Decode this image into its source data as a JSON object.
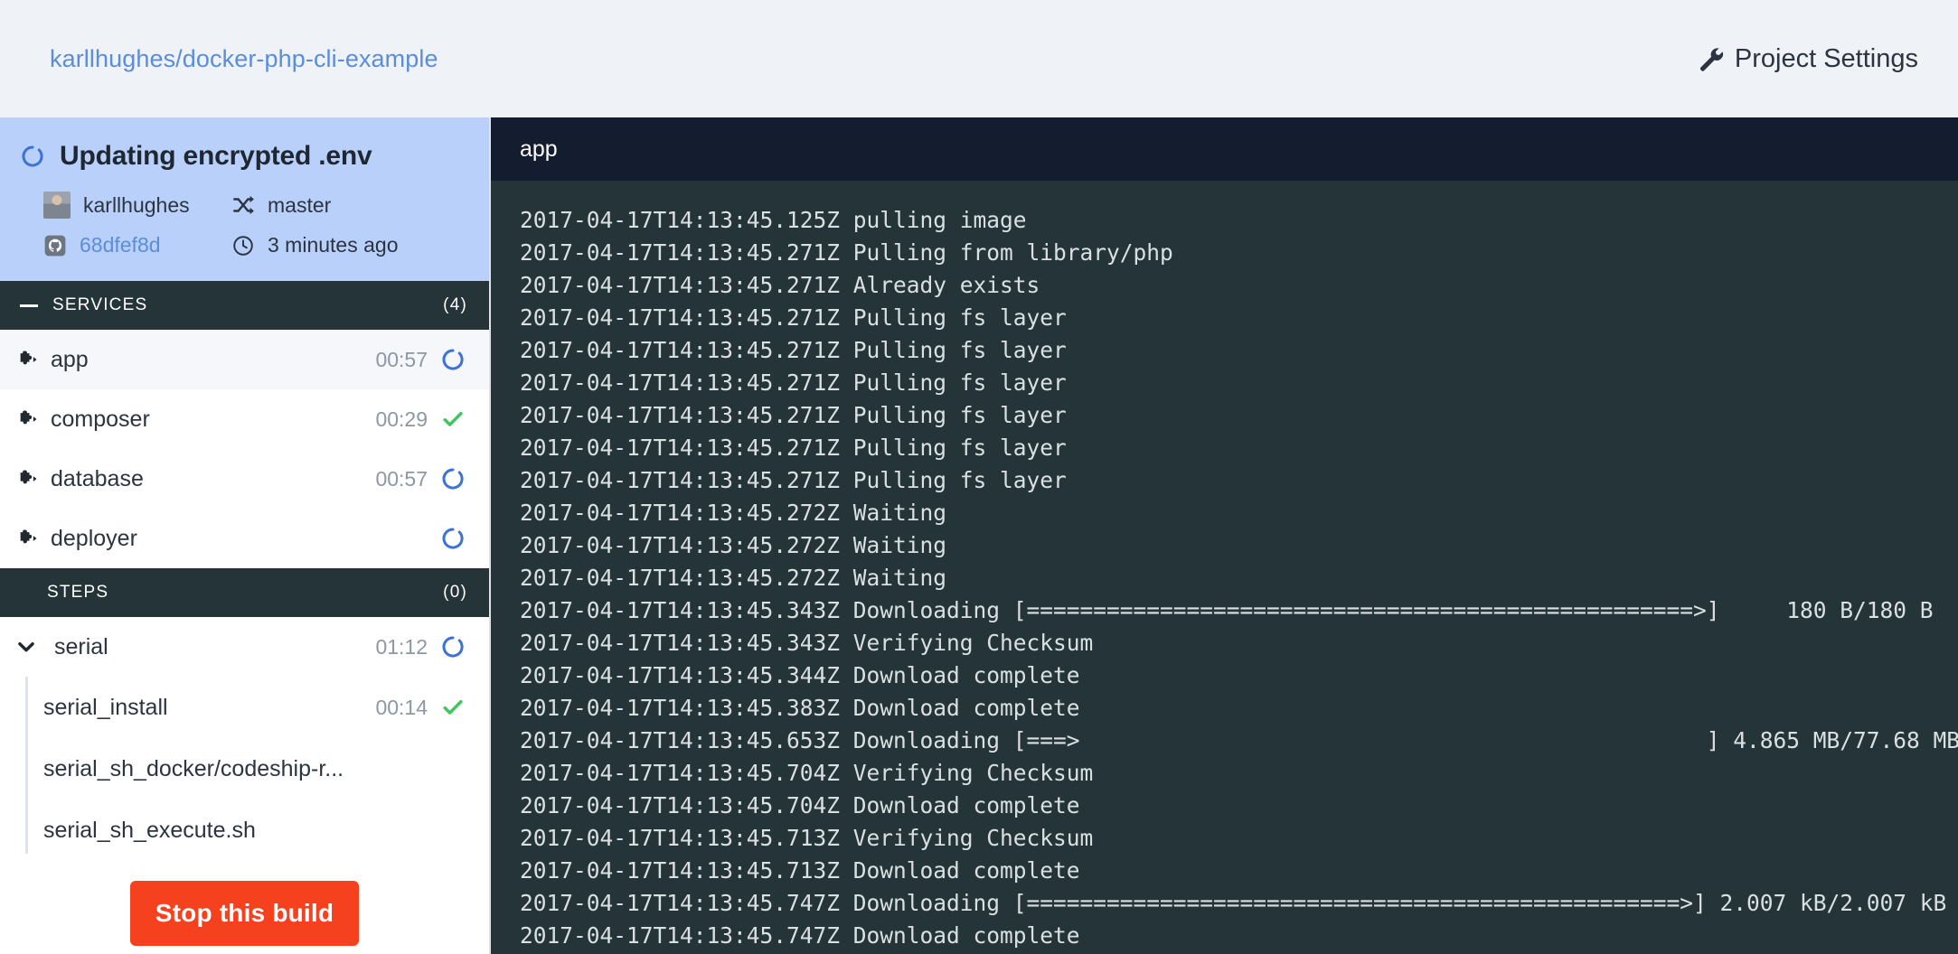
{
  "topbar": {
    "repo": "karllhughes/docker-php-cli-example",
    "settings_label": "Project Settings",
    "settings_icon": "wrench-icon",
    "background": "#eff2f7",
    "link_color": "#5b8dd9"
  },
  "build_info": {
    "status_icon": "spinner-icon",
    "title": "Updating encrypted .env",
    "author": "karllhughes",
    "author_icon": "avatar",
    "branch": "master",
    "branch_icon": "shuffle-icon",
    "commit": "68dfef8d",
    "commit_icon": "github-icon",
    "time": "3 minutes ago",
    "time_icon": "clock-icon",
    "background": "#b8d0fa"
  },
  "services_section": {
    "label": "SERVICES",
    "count": "(4)",
    "collapse_icon": "minus-icon",
    "items": [
      {
        "name": "app",
        "duration": "00:57",
        "status": "spinner-icon",
        "selected": true
      },
      {
        "name": "composer",
        "duration": "00:29",
        "status": "check-icon",
        "selected": false
      },
      {
        "name": "database",
        "duration": "00:57",
        "status": "spinner-icon",
        "selected": false
      },
      {
        "name": "deployer",
        "duration": "",
        "status": "spinner-icon",
        "selected": false
      }
    ]
  },
  "steps_section": {
    "label": "STEPS",
    "count": "(0)",
    "parent": {
      "name": "serial",
      "duration": "01:12",
      "status": "spinner-icon",
      "chevron": "chevron-down-icon"
    },
    "substeps": [
      {
        "name": "serial_install",
        "duration": "00:14",
        "status": "check-icon"
      },
      {
        "name": "serial_sh_docker/codeship-r...",
        "duration": "",
        "status": ""
      },
      {
        "name": "serial_sh_execute.sh",
        "duration": "",
        "status": ""
      }
    ]
  },
  "stop_button": {
    "label": "Stop this build",
    "color": "#f5411e"
  },
  "log": {
    "title": "app",
    "header_background": "#141d30",
    "body_background": "#253439",
    "text_color": "#d9e0e3",
    "lines": [
      "2017-04-17T14:13:45.125Z pulling image",
      "2017-04-17T14:13:45.271Z Pulling from library/php",
      "2017-04-17T14:13:45.271Z Already exists",
      "2017-04-17T14:13:45.271Z Pulling fs layer",
      "2017-04-17T14:13:45.271Z Pulling fs layer",
      "2017-04-17T14:13:45.271Z Pulling fs layer",
      "2017-04-17T14:13:45.271Z Pulling fs layer",
      "2017-04-17T14:13:45.271Z Pulling fs layer",
      "2017-04-17T14:13:45.271Z Pulling fs layer",
      "2017-04-17T14:13:45.272Z Waiting",
      "2017-04-17T14:13:45.272Z Waiting",
      "2017-04-17T14:13:45.272Z Waiting",
      "2017-04-17T14:13:45.343Z Downloading [==================================================>]     180 B/180 B",
      "2017-04-17T14:13:45.343Z Verifying Checksum",
      "2017-04-17T14:13:45.344Z Download complete",
      "2017-04-17T14:13:45.383Z Download complete",
      "2017-04-17T14:13:45.653Z Downloading [===>                                               ] 4.865 MB/77.68 MB",
      "2017-04-17T14:13:45.704Z Verifying Checksum",
      "2017-04-17T14:13:45.704Z Download complete",
      "2017-04-17T14:13:45.713Z Verifying Checksum",
      "2017-04-17T14:13:45.713Z Download complete",
      "2017-04-17T14:13:45.747Z Downloading [=================================================>] 2.007 kB/2.007 kB",
      "2017-04-17T14:13:45.747Z Download complete"
    ]
  }
}
